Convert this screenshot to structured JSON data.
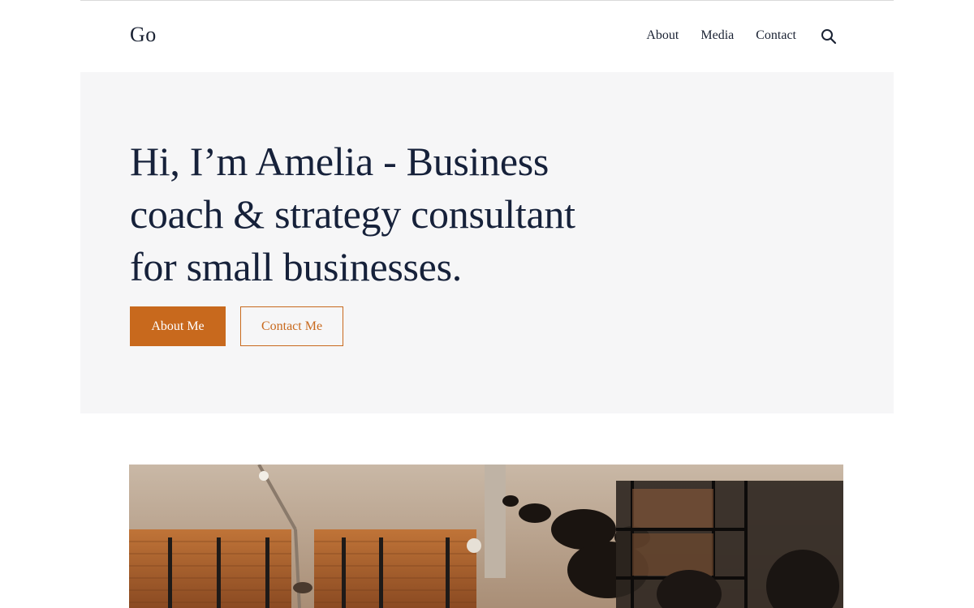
{
  "site": {
    "logo": "Go"
  },
  "nav": {
    "items": [
      "About",
      "Media",
      "Contact"
    ],
    "search_icon": "search-icon"
  },
  "hero": {
    "heading_lines": [
      "Hi, I’m Amelia - Business",
      "coach & strategy consultant",
      "for small businesses."
    ],
    "primary_button": "About Me",
    "secondary_button": "Contact Me"
  },
  "colors": {
    "accent": "#c8691d",
    "text": "#16213a",
    "hero_background": "#f6f6f7"
  },
  "featured_image": {
    "subject": "office-interior-photo"
  }
}
